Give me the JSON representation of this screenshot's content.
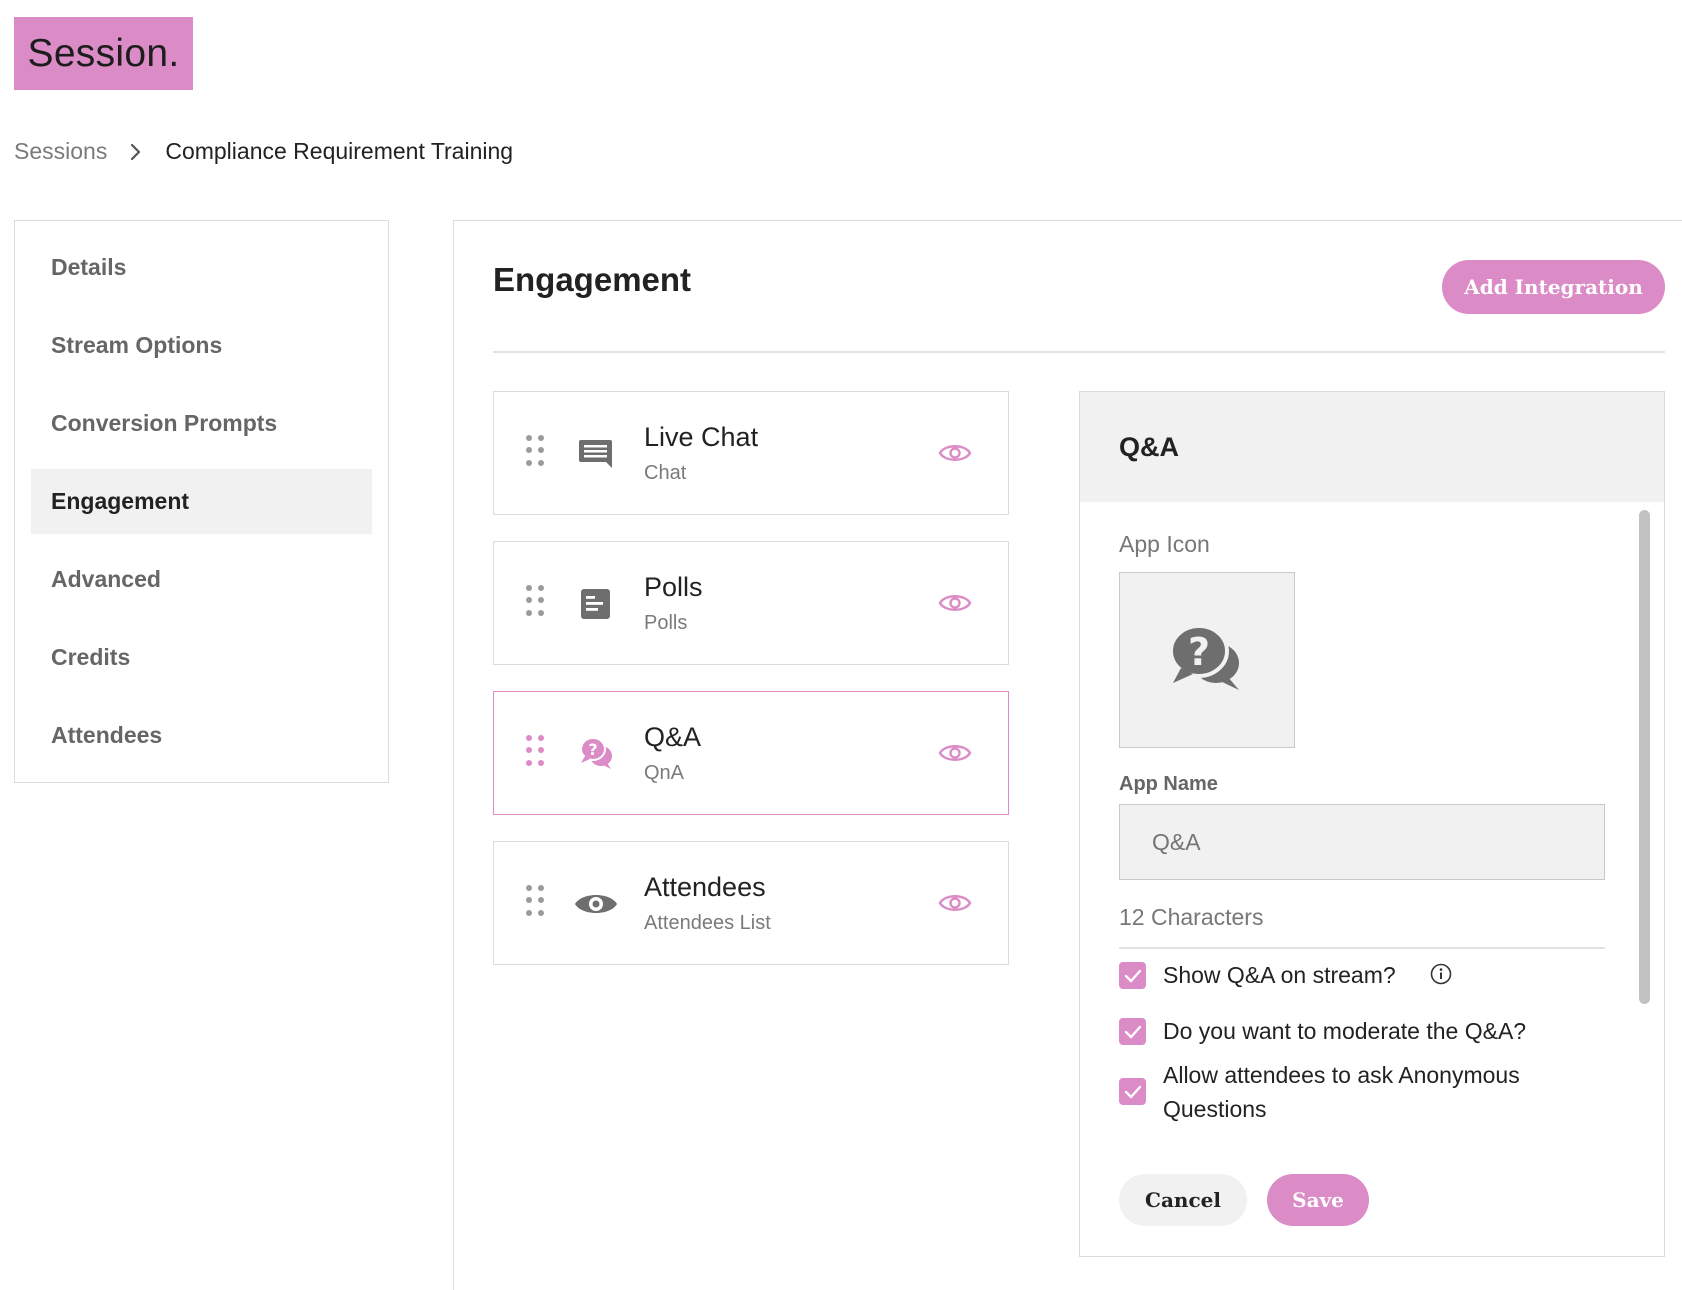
{
  "brand": {
    "logo_text": "Session.",
    "accent_color": "#db8bc6"
  },
  "breadcrumb": {
    "parent": "Sessions",
    "separator_icon": "chevron-right-icon",
    "current": "Compliance Requirement Training"
  },
  "sidebar": {
    "items": [
      {
        "label": "Details",
        "active": false
      },
      {
        "label": "Stream Options",
        "active": false
      },
      {
        "label": "Conversion Prompts",
        "active": false
      },
      {
        "label": "Engagement",
        "active": true
      },
      {
        "label": "Advanced",
        "active": false
      },
      {
        "label": "Credits",
        "active": false
      },
      {
        "label": "Attendees",
        "active": false
      }
    ]
  },
  "main": {
    "title": "Engagement",
    "add_integration_label": "Add Integration",
    "apps": [
      {
        "title": "Live Chat",
        "subtitle": "Chat",
        "icon": "chat-icon",
        "visibility_icon": "eye-icon",
        "selected": false
      },
      {
        "title": "Polls",
        "subtitle": "Polls",
        "icon": "poll-icon",
        "visibility_icon": "eye-icon",
        "selected": false
      },
      {
        "title": "Q&A",
        "subtitle": "QnA",
        "icon": "question-chat-icon",
        "visibility_icon": "eye-icon",
        "selected": true
      },
      {
        "title": "Attendees",
        "subtitle": "Attendees List",
        "icon": "eye-icon",
        "visibility_icon": "eye-icon",
        "selected": false
      }
    ]
  },
  "panel": {
    "title": "Q&A",
    "app_icon_label": "App Icon",
    "app_icon": "question-chat-icon",
    "app_name_label": "App Name",
    "app_name_placeholder": "Q&A",
    "char_count": "12 Characters",
    "options": [
      {
        "label": "Show Q&A on stream?",
        "checked": true,
        "has_info": true
      },
      {
        "label": "Do you want to moderate the Q&A?",
        "checked": true,
        "has_info": false
      },
      {
        "label": "Allow attendees to ask Anonymous Questions",
        "checked": true,
        "has_info": false
      }
    ],
    "cancel_label": "Cancel",
    "save_label": "Save"
  }
}
